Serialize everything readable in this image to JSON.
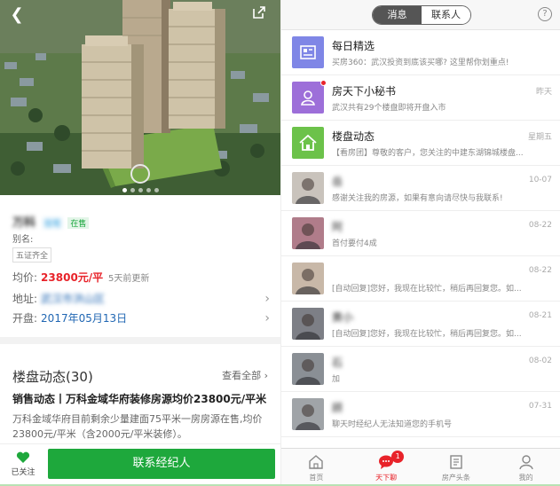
{
  "detail": {
    "property_name": "万科",
    "tags": [
      "住宅",
      "在售"
    ],
    "alias_label": "别名:",
    "feature_tag": "五证齐全",
    "price_label": "均价:",
    "price_value": "23800元/平",
    "price_updated": "5天前更新",
    "address_label": "地址:",
    "address_value": "武汉市洪山区",
    "opening_label": "开盘:",
    "opening_value": "2017年05月13日",
    "dynamics_title": "楼盘动态",
    "dynamics_count": "(30)",
    "view_all": "查看全部",
    "dynamics_headline": "销售动态丨万科金域华府装修房源均价23800元/平米",
    "dynamics_body": "万科金域华府目前剩余少量建面75平米一房房源在售,均价23800元/平米（含2000元/平米装修）。",
    "follow_label": "已关注",
    "contact_button": "联系经纪人"
  },
  "chat": {
    "segments": [
      "消息",
      "联系人"
    ],
    "help": "?",
    "messages": [
      {
        "name": "每日精选",
        "preview": "买房360：武汉投资到底该买哪? 这里帮你划重点!",
        "time": "",
        "icon": "newspaper-icon",
        "color": "#7f86e6"
      },
      {
        "name": "房天下小秘书",
        "preview": "武汉共有29个楼盘即将开盘入市",
        "time": "昨天",
        "icon": "person-icon",
        "color": "#9d6fd9"
      },
      {
        "name": "楼盘动态",
        "preview": "【看房团】尊敬的客户，您关注的中建东湖锦城楼盘...",
        "time": "星期五",
        "icon": "house-icon",
        "color": "#6cc24a"
      },
      {
        "name": "岳",
        "preview": "感谢关注我的房源，如果有意向请尽快与我联系!",
        "time": "10-07",
        "icon": "agent-photo",
        "color": "#c9c3bc"
      },
      {
        "name": "阿",
        "preview": "首付要付4成",
        "time": "08-22",
        "icon": "agent-photo",
        "color": "#b07c8a"
      },
      {
        "name": "",
        "preview": "[自动回复]您好，我现在比较忙，稍后再回复您。如...",
        "time": "08-22",
        "icon": "agent-photo",
        "color": "#c8b8a8"
      },
      {
        "name": "黄小",
        "preview": "[自动回复]您好，我现在比较忙，稍后再回复您。如...",
        "time": "08-21",
        "icon": "agent-photo",
        "color": "#7d7f86"
      },
      {
        "name": "石",
        "preview": "加",
        "time": "08-02",
        "icon": "agent-photo",
        "color": "#8a8f95"
      },
      {
        "name": "顾",
        "preview": "聊天时经纪人无法知道您的手机号",
        "time": "07-31",
        "icon": "agent-photo",
        "color": "#a0a4a8"
      }
    ],
    "tabs": [
      {
        "label": "首页",
        "icon": "home-icon"
      },
      {
        "label": "天下聊",
        "icon": "chat-icon",
        "badge": "1"
      },
      {
        "label": "房产头条",
        "icon": "news-icon"
      },
      {
        "label": "我的",
        "icon": "profile-icon"
      }
    ]
  }
}
